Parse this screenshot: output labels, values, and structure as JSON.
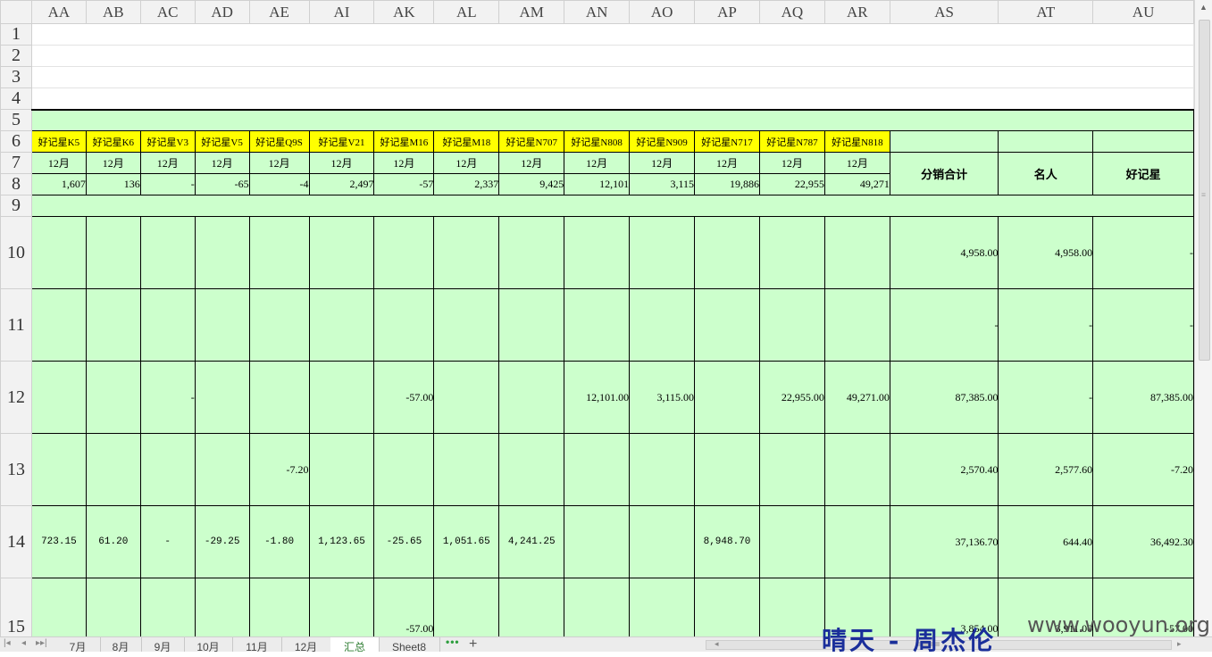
{
  "columns": [
    "AA",
    "AB",
    "AC",
    "AD",
    "AE",
    "AI",
    "AK",
    "AL",
    "AM",
    "AN",
    "AO",
    "AP",
    "AQ",
    "AR",
    "AS",
    "AT",
    "AU"
  ],
  "row_numbers": [
    "1",
    "2",
    "3",
    "4",
    "5",
    "6",
    "7",
    "8",
    "9",
    "10",
    "11",
    "12",
    "13",
    "14",
    "15"
  ],
  "products": [
    "好记星K5",
    "好记星K6",
    "好记星V3",
    "好记星V5",
    "好记星Q9S",
    "好记星V21",
    "好记星M16",
    "好记星M18",
    "好记星N707",
    "好记星N808",
    "好记星N909",
    "好记星N717",
    "好记星N787",
    "好记星N818"
  ],
  "month": "12月",
  "row8": [
    "1,607",
    "136",
    "-",
    "-65",
    "-4",
    "2,497",
    "-57",
    "2,337",
    "9,425",
    "12,101",
    "3,115",
    "19,886",
    "22,955",
    "49,271"
  ],
  "summary_headers": {
    "total": "分销合计",
    "celebrity": "名人",
    "haojixing": "好记星"
  },
  "rows": {
    "r10": [
      "",
      "",
      "",
      "",
      "",
      "",
      "",
      "",
      "",
      "",
      "",
      "",
      "",
      "",
      "4,958.00",
      "4,958.00",
      "-"
    ],
    "r11": [
      "",
      "",
      "",
      "",
      "",
      "",
      "",
      "",
      "",
      "",
      "",
      "",
      "",
      "",
      "-",
      "-",
      "-"
    ],
    "r12": [
      "",
      "",
      "-",
      "",
      "",
      "",
      "-57.00",
      "",
      "",
      "12,101.00",
      "3,115.00",
      "",
      "22,955.00",
      "49,271.00",
      "87,385.00",
      "-",
      "87,385.00"
    ],
    "r13": [
      "",
      "",
      "",
      "",
      "-7.20",
      "",
      "",
      "",
      "",
      "",
      "",
      "",
      "",
      "",
      "2,570.40",
      "2,577.60",
      "-7.20"
    ],
    "r14": [
      "723.15",
      "61.20",
      "-",
      "-29.25",
      "-1.80",
      "1,123.65",
      "-25.65",
      "1,051.65",
      "4,241.25",
      "",
      "",
      "8,948.70",
      "",
      "",
      "37,136.70",
      "644.40",
      "36,492.30"
    ],
    "r15": [
      "",
      "",
      "",
      "",
      "",
      "",
      "-57.00",
      "",
      "",
      "",
      "",
      "",
      "",
      "",
      "3,854.00",
      "3,911.00",
      "-57.00"
    ]
  },
  "sheet_tabs": [
    "7月",
    "8月",
    "9月",
    "10月",
    "11月",
    "12月",
    "汇总",
    "Sheet8"
  ],
  "active_tab": "汇总",
  "tab_more": "•••",
  "tab_add": "+",
  "watermark": {
    "text": "晴天 - 周杰伦",
    "url": "www.wooyun.org"
  },
  "colors": {
    "cell_green": "#ccffcc",
    "header_yellow": "#ffff00"
  }
}
